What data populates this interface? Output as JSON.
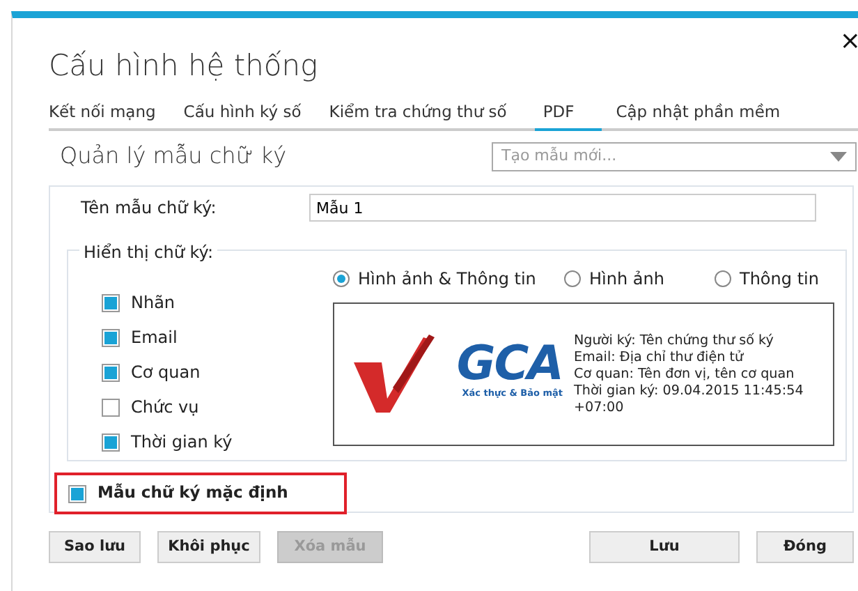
{
  "dialog": {
    "title": "Cấu hình hệ thống",
    "close": "×"
  },
  "tabs": [
    {
      "label": "Kết nối mạng",
      "selected": false
    },
    {
      "label": "Cấu hình ký số",
      "selected": false
    },
    {
      "label": "Kiểm tra chứng thư số",
      "selected": false
    },
    {
      "label": "PDF",
      "selected": true
    },
    {
      "label": "Cập nhật phần mềm",
      "selected": false
    }
  ],
  "section": {
    "title": "Quản lý mẫu chữ ký",
    "template_select": {
      "placeholder": "Tạo mẫu mới..."
    }
  },
  "name_field": {
    "label": "Tên mẫu chữ ký:",
    "value": "Mẫu 1"
  },
  "display": {
    "legend": "Hiển thị chữ ký:",
    "modes": [
      {
        "label": "Hình ảnh & Thông tin",
        "selected": true
      },
      {
        "label": "Hình ảnh",
        "selected": false
      },
      {
        "label": "Thông tin",
        "selected": false
      }
    ],
    "fields": [
      {
        "label": "Nhãn",
        "checked": true
      },
      {
        "label": "Email",
        "checked": true
      },
      {
        "label": "Cơ quan",
        "checked": true
      },
      {
        "label": "Chức vụ",
        "checked": false
      },
      {
        "label": "Thời gian ký",
        "checked": true
      }
    ],
    "preview": {
      "logo_text": "GCA",
      "logo_tagline": "Xác thực & Bảo mật",
      "lines": [
        "Người ký: Tên chứng thư số ký",
        "Email: Địa chỉ thư điện tử",
        "Cơ quan: Tên đơn vị, tên cơ quan",
        "Thời gian ký: 09.04.2015 11:45:54 +07:00"
      ]
    }
  },
  "default_template": {
    "label": "Mẫu chữ ký mặc định",
    "checked": true,
    "highlighted": true
  },
  "left_buttons": [
    {
      "label": "Sao lưu",
      "disabled": false
    },
    {
      "label": "Khôi phục",
      "disabled": false
    },
    {
      "label": "Xóa mẫu",
      "disabled": true
    }
  ],
  "right_buttons": [
    {
      "label": "Lưu",
      "disabled": false
    },
    {
      "label": "Đóng",
      "disabled": false
    }
  ]
}
